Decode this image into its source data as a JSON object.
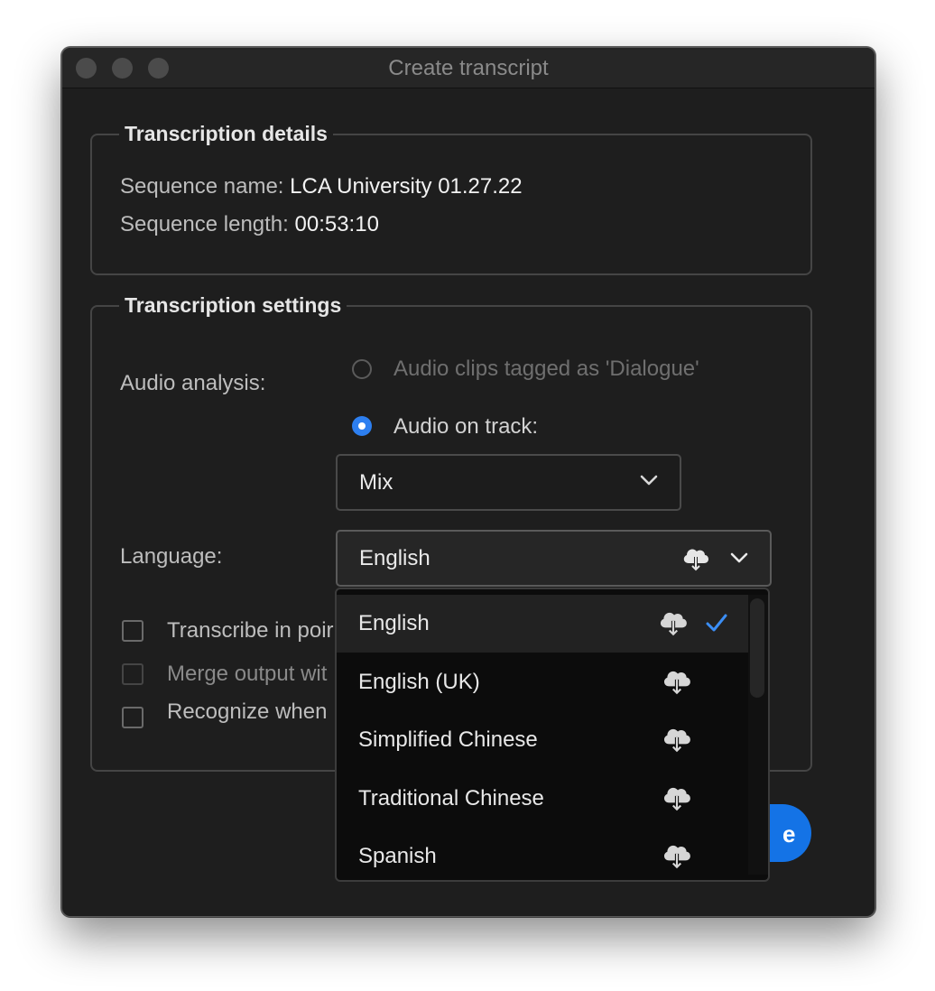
{
  "window": {
    "title": "Create transcript"
  },
  "details": {
    "legend": "Transcription details",
    "sequence_name_label": "Sequence name:",
    "sequence_name_value": "LCA University 01.27.22",
    "sequence_length_label": "Sequence length:",
    "sequence_length_value": "00:53:10"
  },
  "settings": {
    "legend": "Transcription settings",
    "audio_analysis_label": "Audio analysis:",
    "radio_dialogue_label": "Audio clips tagged as 'Dialogue'",
    "radio_track_label": "Audio on track:",
    "track_select_value": "Mix",
    "language_label": "Language:",
    "language_select_value": "English",
    "checkbox_1_label": "Transcribe in poir",
    "checkbox_2_label": "Merge output wit",
    "checkbox_3_label": "Recognize when"
  },
  "primary_button_label": "e",
  "dropdown": {
    "options": [
      "English",
      "English (UK)",
      "Simplified Chinese",
      "Traditional Chinese",
      "Spanish"
    ],
    "selected": "English"
  },
  "colors": {
    "accent": "#2d7ff0",
    "button": "#1473e6",
    "background": "#1e1e1e"
  },
  "icons": {
    "cloud": "cloud-download-icon",
    "chevron": "chevron-down-icon",
    "check": "checkmark-icon"
  }
}
